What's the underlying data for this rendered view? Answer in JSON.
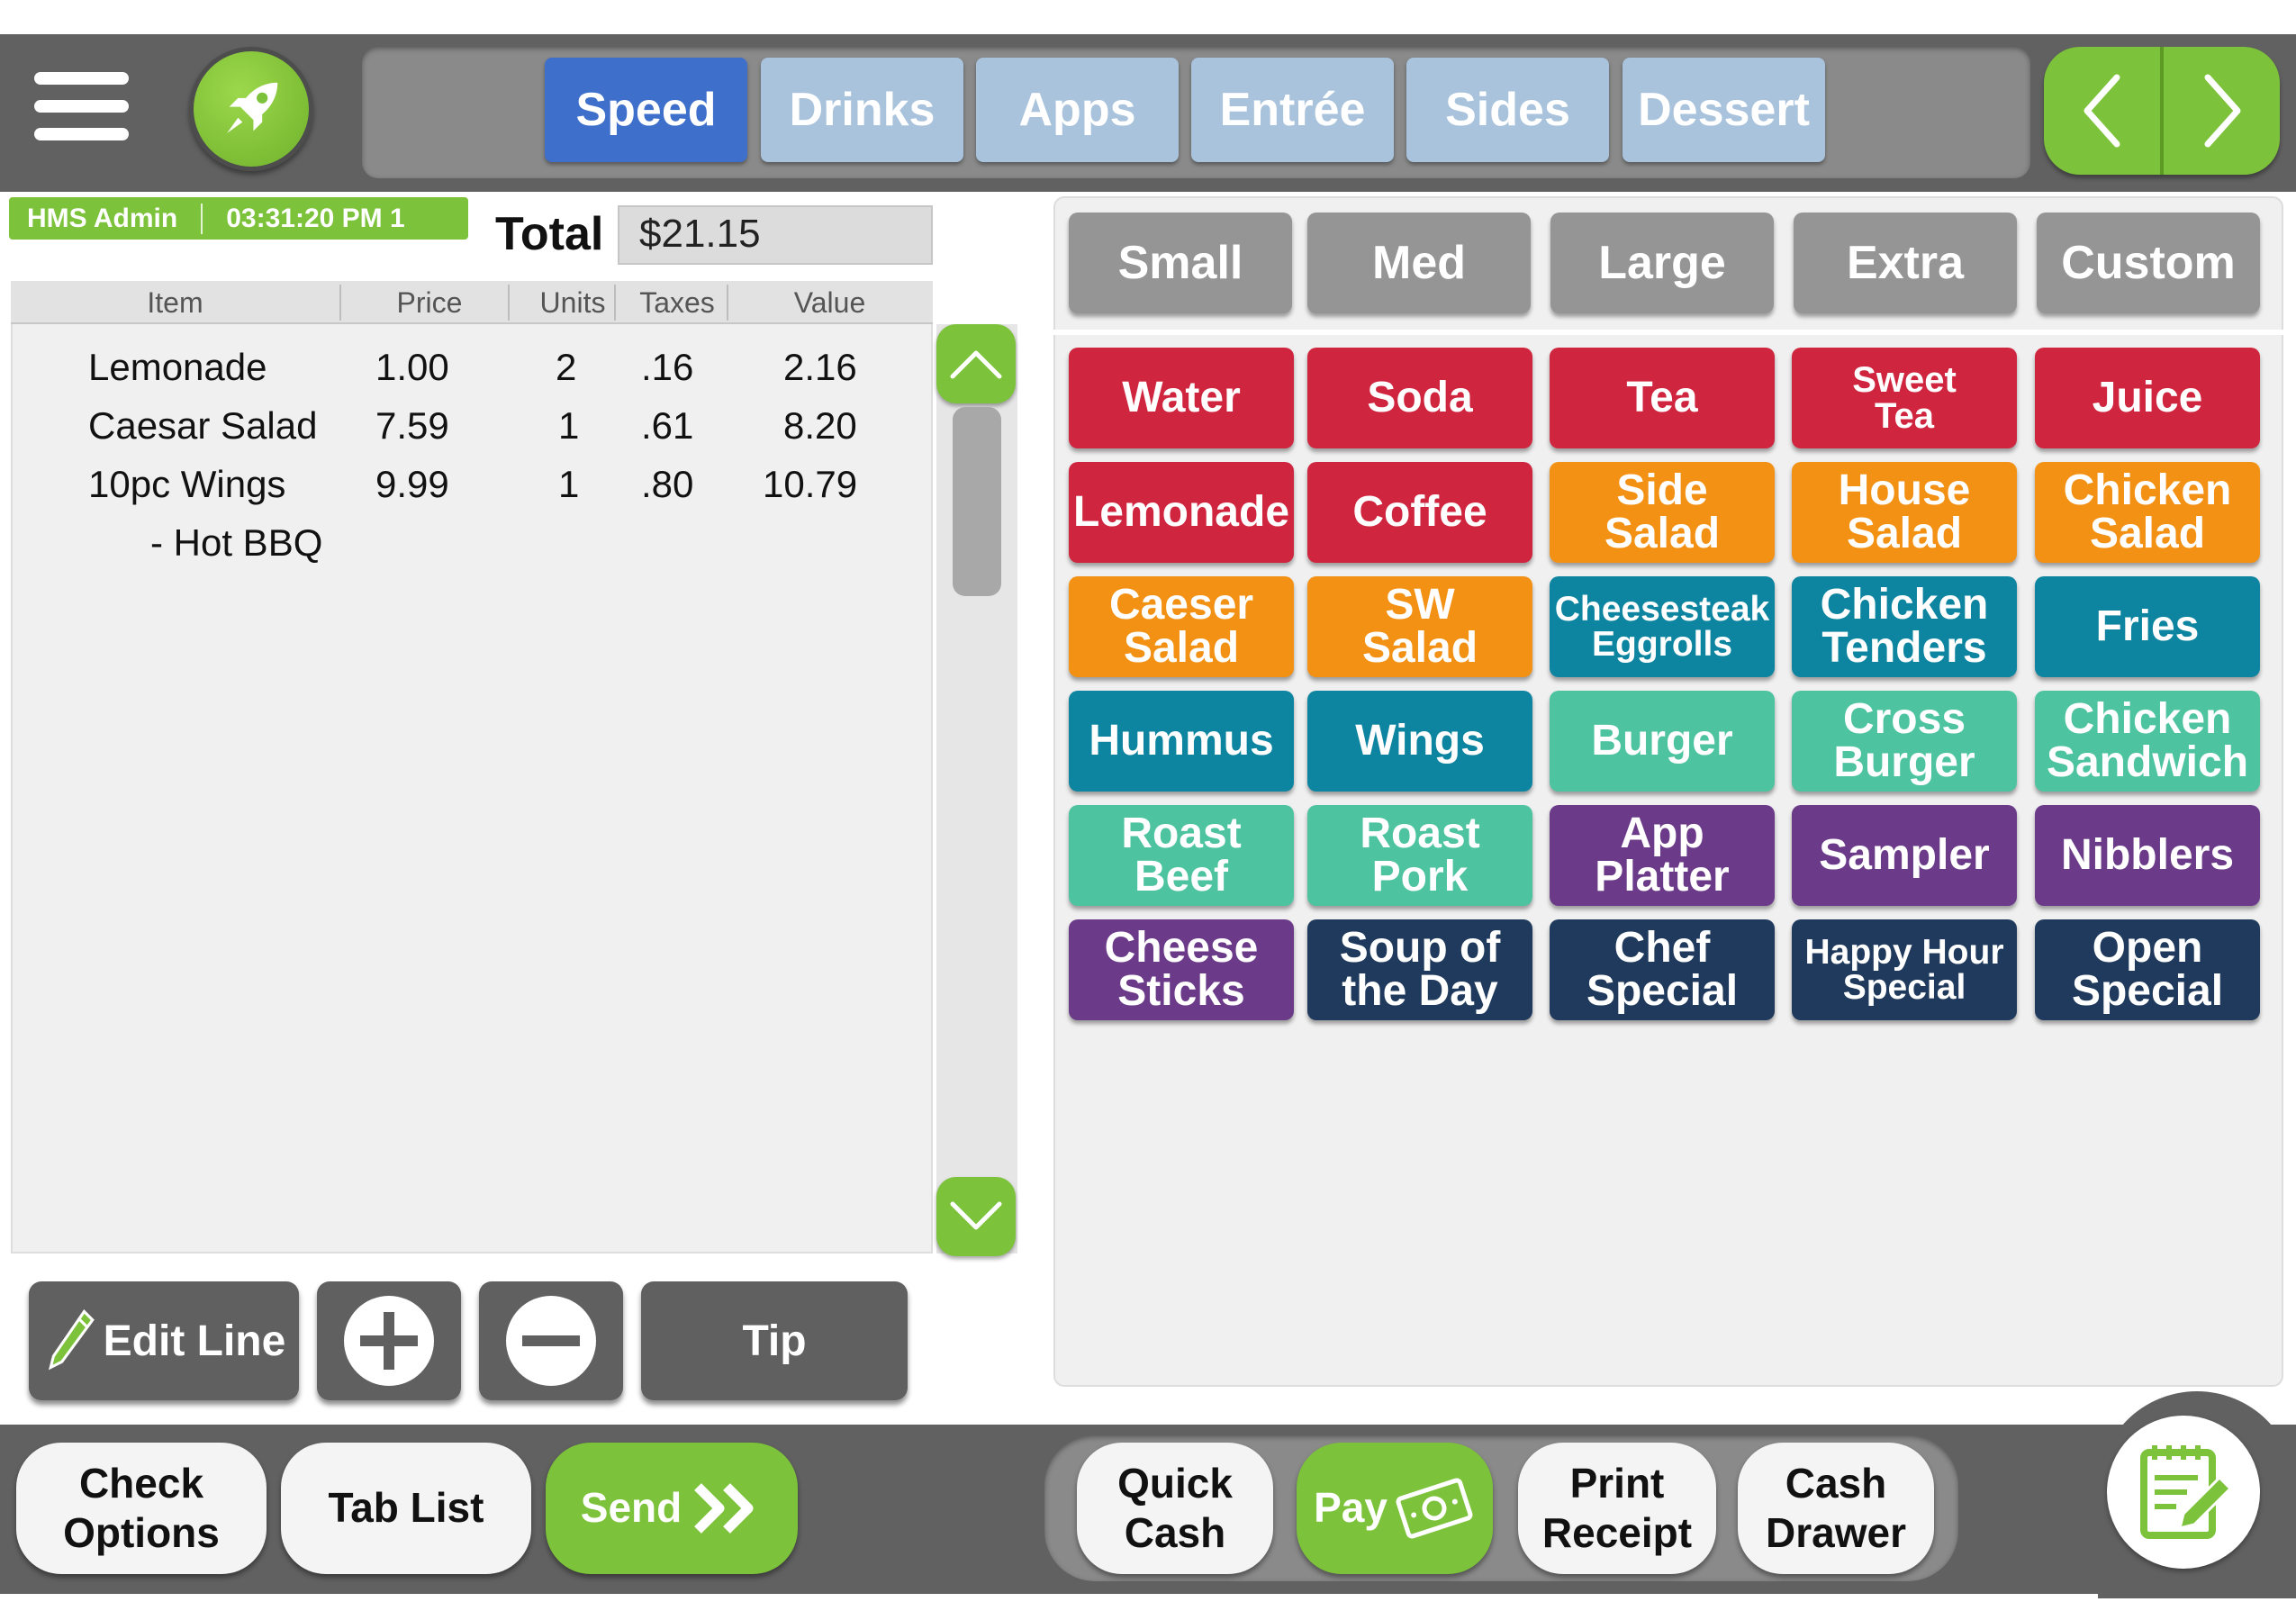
{
  "header": {
    "menu_icon": "hamburger-icon",
    "launch_icon": "rocket-icon",
    "tabs": [
      {
        "label": "Speed",
        "active": true
      },
      {
        "label": "Drinks",
        "active": false
      },
      {
        "label": "Apps",
        "active": false
      },
      {
        "label": "Entrée",
        "active": false
      },
      {
        "label": "Sides",
        "active": false
      },
      {
        "label": "Dessert",
        "active": false
      }
    ],
    "nav": {
      "prev_icon": "chevron-left-icon",
      "next_icon": "chevron-right-icon"
    }
  },
  "status": {
    "user": "HMS Admin",
    "time": "03:31:20 PM 1"
  },
  "order": {
    "total_label": "Total",
    "total_value": "$21.15",
    "columns": [
      "Item",
      "Price",
      "Units",
      "Taxes",
      "Value"
    ],
    "lines": [
      {
        "item": "Lemonade",
        "price": "1.00",
        "units": "2",
        "taxes": ".16",
        "value": "2.16"
      },
      {
        "item": "Caesar Salad",
        "price": "7.59",
        "units": "1",
        "taxes": ".61",
        "value": "8.20"
      },
      {
        "item": "10pc Wings",
        "price": "9.99",
        "units": "1",
        "taxes": ".80",
        "value": "10.79"
      }
    ],
    "modifier": "- Hot BBQ"
  },
  "order_actions": {
    "edit_line": "Edit Line",
    "edit_icon": "pencil-icon",
    "add_icon": "plus-icon",
    "remove_icon": "minus-icon",
    "tip": "Tip"
  },
  "sizes": [
    "Small",
    "Med",
    "Large",
    "Extra",
    "Custom"
  ],
  "colors": {
    "red": "#d0253f",
    "orange": "#f39114",
    "teal": "#0e85a0",
    "mint": "#4dc3a0",
    "purple": "#6b3b8a",
    "navy": "#1f3a5c",
    "green": "#7cc23a",
    "active_tab": "#3d6fcb",
    "tab": "#a9c3dd"
  },
  "items": [
    [
      {
        "label": "Water",
        "color": "red"
      },
      {
        "label": "Soda",
        "color": "red"
      },
      {
        "label": "Tea",
        "color": "red"
      },
      {
        "label": "Sweet\nTea",
        "color": "red"
      },
      {
        "label": "Juice",
        "color": "red"
      }
    ],
    [
      {
        "label": "Lemonade",
        "color": "red"
      },
      {
        "label": "Coffee",
        "color": "red"
      },
      {
        "label": "Side\nSalad",
        "color": "orange"
      },
      {
        "label": "House\nSalad",
        "color": "orange"
      },
      {
        "label": "Chicken\nSalad",
        "color": "orange"
      }
    ],
    [
      {
        "label": "Caeser\nSalad",
        "color": "orange"
      },
      {
        "label": "SW\nSalad",
        "color": "orange"
      },
      {
        "label": "Cheesesteak\nEggrolls",
        "color": "teal"
      },
      {
        "label": "Chicken\nTenders",
        "color": "teal"
      },
      {
        "label": "Fries",
        "color": "teal"
      }
    ],
    [
      {
        "label": "Hummus",
        "color": "teal"
      },
      {
        "label": "Wings",
        "color": "teal"
      },
      {
        "label": "Burger",
        "color": "mint"
      },
      {
        "label": "Cross\nBurger",
        "color": "mint"
      },
      {
        "label": "Chicken\nSandwich",
        "color": "mint"
      }
    ],
    [
      {
        "label": "Roast\nBeef",
        "color": "mint"
      },
      {
        "label": "Roast\nPork",
        "color": "mint"
      },
      {
        "label": "App\nPlatter",
        "color": "purple"
      },
      {
        "label": "Sampler",
        "color": "purple"
      },
      {
        "label": "Nibblers",
        "color": "purple"
      }
    ],
    [
      {
        "label": "Cheese\nSticks",
        "color": "purple"
      },
      {
        "label": "Soup of\nthe Day",
        "color": "navy"
      },
      {
        "label": "Chef\nSpecial",
        "color": "navy"
      },
      {
        "label": "Happy Hour\nSpecial",
        "color": "navy"
      },
      {
        "label": "Open\nSpecial",
        "color": "navy"
      }
    ]
  ],
  "footer": {
    "check_options": "Check\nOptions",
    "tab_list": "Tab List",
    "send": "Send",
    "send_icon": "double-chevron-right-icon",
    "quick_cash": "Quick\nCash",
    "pay": "Pay",
    "pay_icon": "cash-icon",
    "print_receipt": "Print\nReceipt",
    "cash_drawer": "Cash\nDrawer",
    "notes_icon": "notepad-edit-icon"
  }
}
